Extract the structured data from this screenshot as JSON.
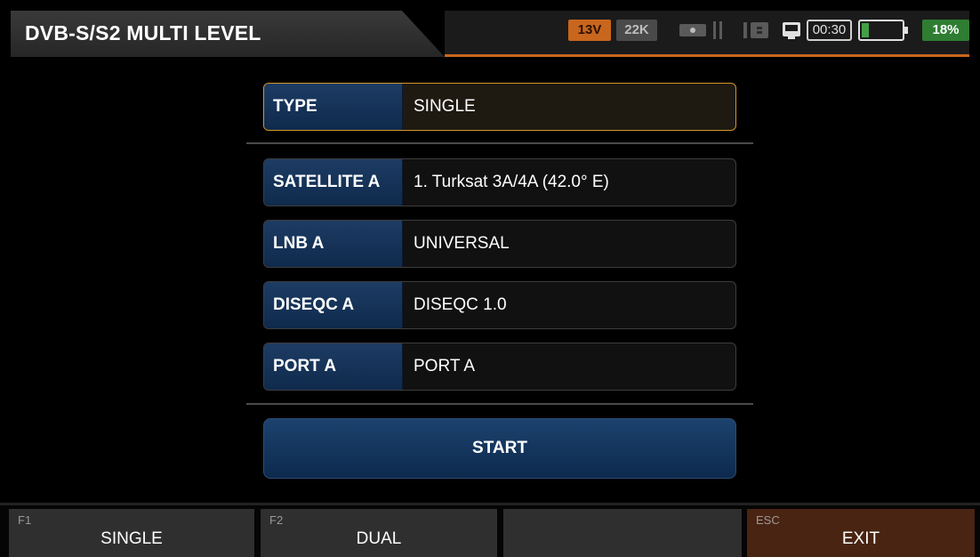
{
  "header": {
    "title": "DVB-S/S2 MULTI LEVEL",
    "status": {
      "voltage": "13V",
      "tone": "22K",
      "time": "00:30",
      "battery_percent": "18%",
      "battery_level": 0.18,
      "colors": {
        "accent": "#c8661e",
        "battery_ok": "#2e7d32"
      },
      "icons": [
        "lnb-power-icon",
        "sd-card-icon",
        "monitor-icon",
        "battery-icon"
      ]
    }
  },
  "rows": [
    {
      "label": "TYPE",
      "value": "SINGLE"
    },
    {
      "label": "SATELLITE A",
      "value": "1. Turksat 3A/4A (42.0° E)"
    },
    {
      "label": "LNB A",
      "value": "UNIVERSAL"
    },
    {
      "label": "DISEQC A",
      "value": "DISEQC 1.0"
    },
    {
      "label": "PORT A",
      "value": "PORT A"
    }
  ],
  "start_label": "START",
  "fkeys": [
    {
      "key": "F1",
      "label": "SINGLE"
    },
    {
      "key": "F2",
      "label": "DUAL"
    },
    {
      "key": "ESC",
      "label": "EXIT"
    }
  ]
}
